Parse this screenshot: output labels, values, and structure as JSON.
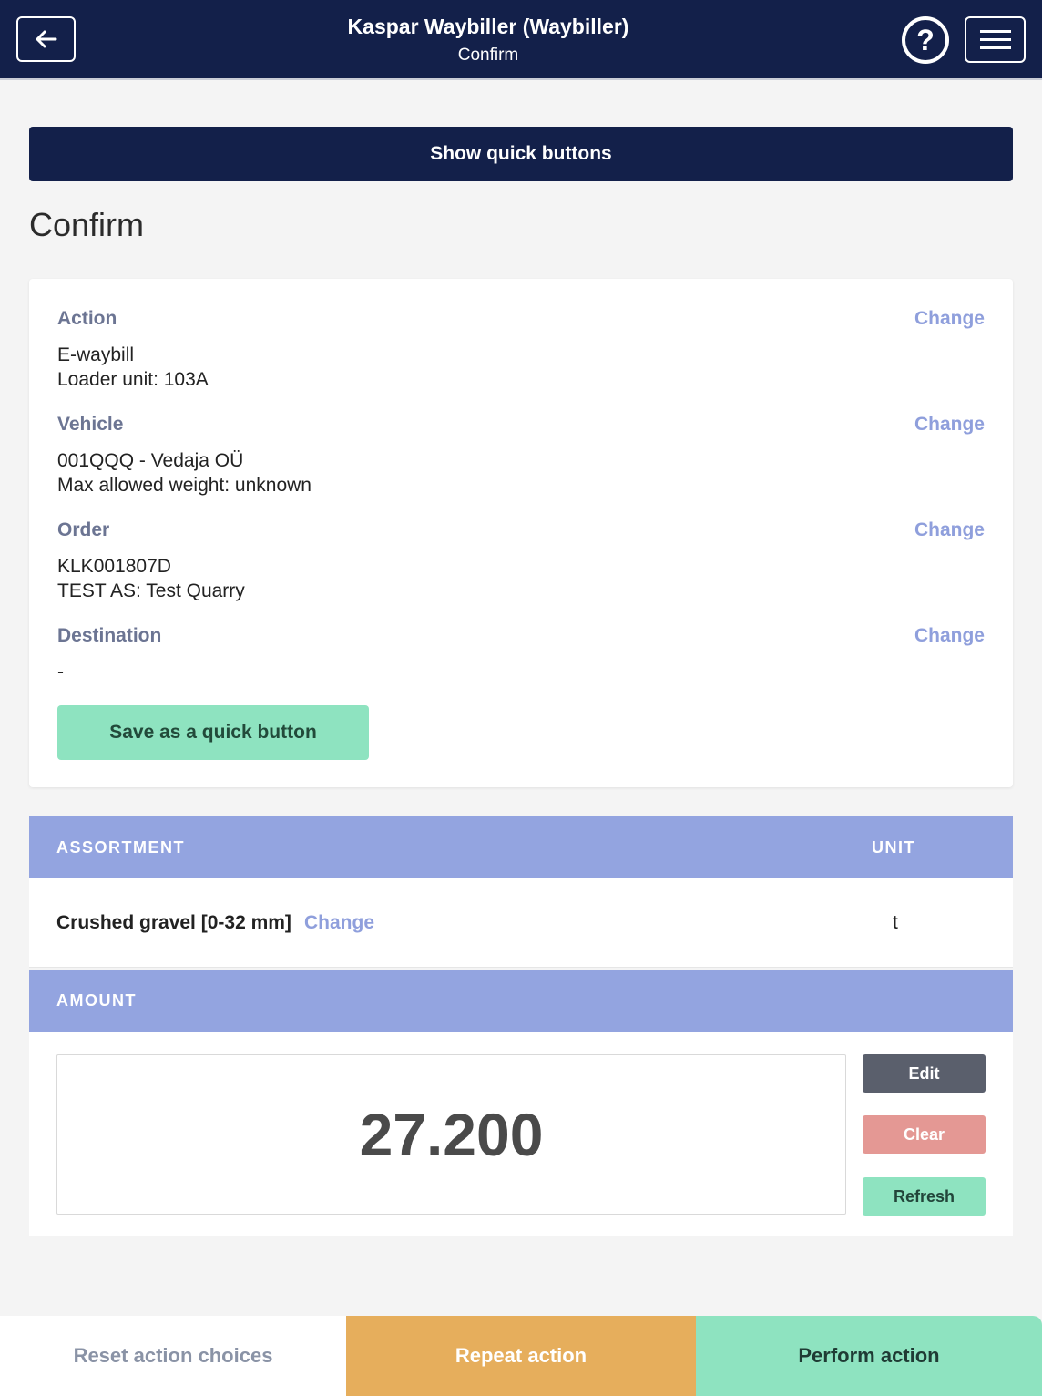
{
  "header": {
    "title": "Kaspar Waybiller (Waybiller)",
    "subtitle": "Confirm",
    "help_symbol": "?",
    "icons": [
      "back-arrow-icon",
      "help-icon",
      "hamburger-menu-icon"
    ]
  },
  "quick_buttons": {
    "label": "Show quick buttons"
  },
  "page": {
    "title": "Confirm"
  },
  "summary": {
    "change_label": "Change",
    "action": {
      "label": "Action",
      "line1": "E-waybill",
      "line2": "Loader unit: 103A"
    },
    "vehicle": {
      "label": "Vehicle",
      "line1": "001QQQ - Vedaja OÜ",
      "line2": "Max allowed weight: unknown"
    },
    "order": {
      "label": "Order",
      "line1": "KLK001807D",
      "line2": "TEST AS: Test Quarry"
    },
    "destination": {
      "label": "Destination",
      "line1": "-"
    },
    "save_quick_label": "Save as a quick button"
  },
  "assortment_table": {
    "col_assortment": "ASSORTMENT",
    "col_unit": "UNIT",
    "row": {
      "name": "Crushed gravel [0-32 mm]",
      "change": "Change",
      "unit": "t"
    }
  },
  "amount": {
    "header": "AMOUNT",
    "value": "27.200",
    "edit_label": "Edit",
    "clear_label": "Clear",
    "refresh_label": "Refresh"
  },
  "footer": {
    "reset_label": "Reset action choices",
    "repeat_label": "Repeat action",
    "perform_label": "Perform action"
  },
  "colors": {
    "navy": "#13204a",
    "accent_blue": "#93a4e0",
    "link_blue": "#8f9fdc",
    "green": "#8ee3c0",
    "orange": "#e6ae5c",
    "red": "#e49894",
    "gray_button": "#5a5f6c"
  }
}
